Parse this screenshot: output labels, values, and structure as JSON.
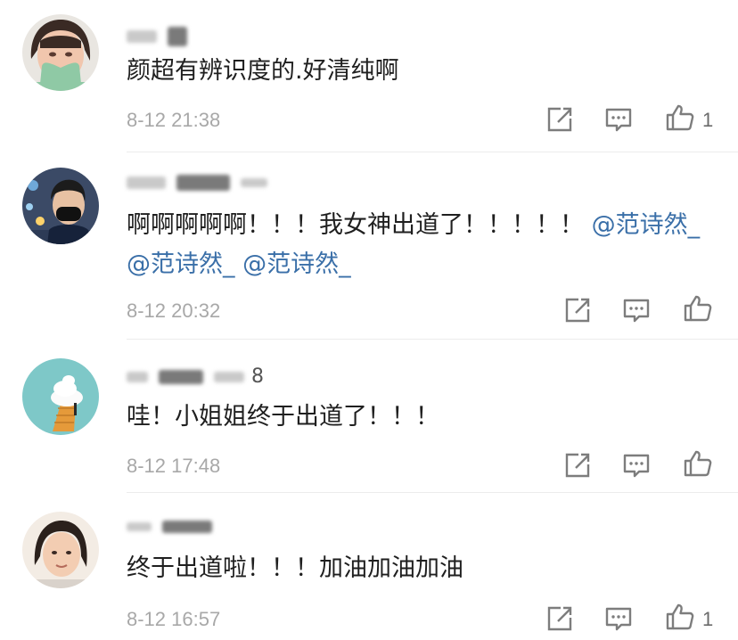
{
  "comments": [
    {
      "username": "",
      "text_plain": "颜超有辨识度的.好清纯啊",
      "time": "8-12 21:38",
      "like_count": "1",
      "avatar_icon": "avatar-girl-green-mask-icon"
    },
    {
      "username": "",
      "text_plain": "啊啊啊啊啊！！！我女神出道了！！！！！",
      "mentions": [
        "@范诗然_",
        "@范诗然_",
        "@范诗然_"
      ],
      "time": "8-12 20:32",
      "like_count": "",
      "avatar_icon": "avatar-man-black-mask-icon"
    },
    {
      "username": "8",
      "text_plain": "哇！小姐姐终于出道了！！！",
      "time": "8-12 17:48",
      "like_count": "",
      "avatar_icon": "avatar-ice-cream-icon"
    },
    {
      "username": "",
      "text_plain": "终于出道啦！！！加油加油加油",
      "time": "8-12 16:57",
      "like_count": "1",
      "avatar_icon": "avatar-girl-selfie-icon"
    }
  ],
  "colors": {
    "mention": "#3a6fa8",
    "time": "#a8a8a8",
    "icon": "#7d7d7d",
    "divider": "#ececec"
  }
}
